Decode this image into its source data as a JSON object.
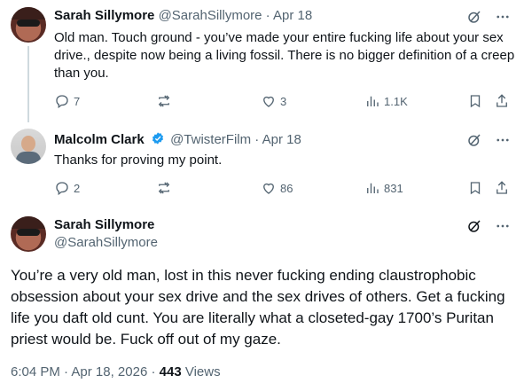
{
  "replies": [
    {
      "name": "Sarah Sillymore",
      "handle": "@SarahSillymore",
      "dot": "·",
      "date": "Apr 18",
      "text": "Old man. Touch ground - you’ve made your entire fucking life about your sex drive., despite now being a living fossil. There is no bigger definition of a creep than you.",
      "replies_count": "7",
      "reposts_count": "",
      "likes_count": "3",
      "views_count": "1.1K"
    },
    {
      "name": "Malcolm Clark",
      "verified": true,
      "handle": "@TwisterFilm",
      "dot": "·",
      "date": "Apr 18",
      "text": "Thanks for proving my point.",
      "replies_count": "2",
      "reposts_count": "",
      "likes_count": "86",
      "views_count": "831"
    }
  ],
  "main_tweet": {
    "name": "Sarah Sillymore",
    "handle": "@SarahSillymore",
    "text": "You’re a very old man, lost in this never fucking ending claustrophobic obsession about your sex drive and the sex drives of others.  Get a fucking life you daft old cunt.  You are literally what a closeted-gay 1700’s Puritan priest would be. Fuck off out of my gaze.",
    "time": "6:04 PM",
    "dot": "·",
    "date": "Apr 18, 2026",
    "views_count": "443",
    "views_label": "Views"
  },
  "colors": {
    "text": "#0f1419",
    "secondary": "#536471",
    "verified": "#1d9bf0",
    "thread_line": "#cfd9de"
  },
  "icons": [
    "grok-icon",
    "more-icon",
    "reply-icon",
    "repost-icon",
    "like-icon",
    "views-icon",
    "bookmark-icon",
    "share-icon",
    "verified-icon"
  ]
}
